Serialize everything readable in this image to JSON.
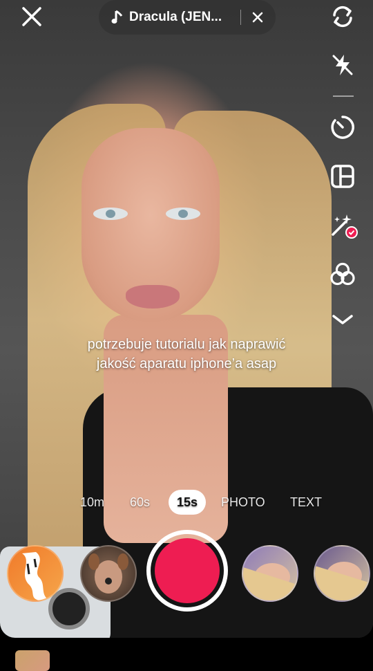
{
  "music": {
    "note_icon": "music-note-icon",
    "title": "Dracula (JEN..."
  },
  "side_tools": [
    {
      "name": "flip-camera-icon"
    },
    {
      "name": "flash-off-icon"
    },
    {
      "name": "timer-icon"
    },
    {
      "name": "layout-grid-icon"
    },
    {
      "name": "enhance-sparkle-icon"
    },
    {
      "name": "filters-icon"
    },
    {
      "name": "chevron-down-icon"
    }
  ],
  "caption": {
    "line1": "potrzebuje tutorialu jak naprawić",
    "line2": "jakość aparatu iphone’a asap"
  },
  "modes": {
    "m10": "10m",
    "m60": "60s",
    "m15": "15s",
    "photo": "PHOTO",
    "text": "TEXT",
    "selected": "15s"
  },
  "colors": {
    "record": "#ee1d52",
    "pill_bg": "#323232"
  }
}
